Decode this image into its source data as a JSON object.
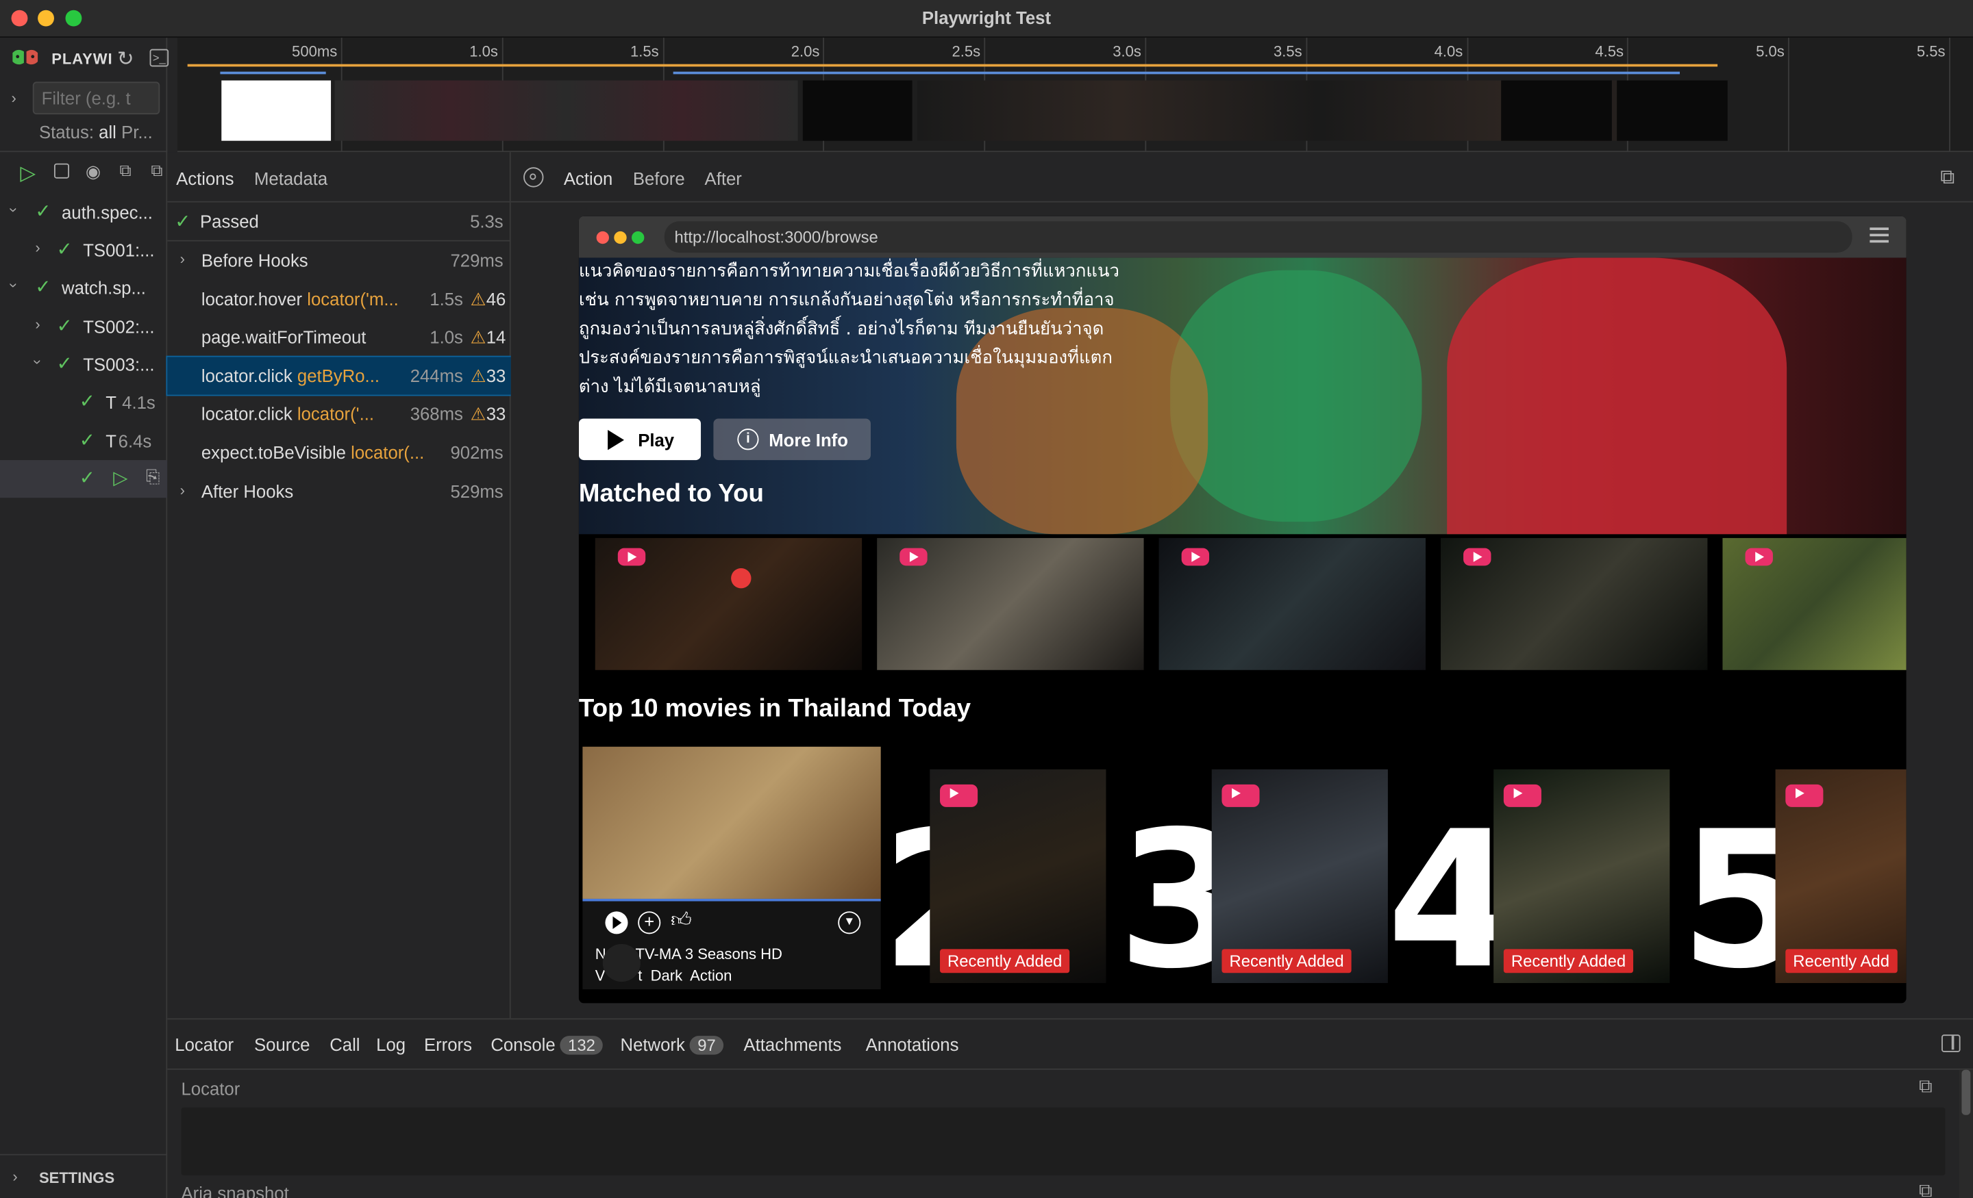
{
  "window": {
    "title": "Playwright Test"
  },
  "sidebar": {
    "app_name": "PLAYWI",
    "filter_placeholder": "Filter (e.g. t",
    "status_label": "Status:",
    "status_value": "all",
    "projects_label": "Pr...",
    "tree": [
      {
        "label": "auth.spec...",
        "indent": 0,
        "expanded": true
      },
      {
        "label": "TS001:...",
        "indent": 1,
        "expanded": false
      },
      {
        "label": "watch.sp...",
        "indent": 0,
        "expanded": true
      },
      {
        "label": "TS002:...",
        "indent": 1,
        "expanded": false
      },
      {
        "label": "TS003:...",
        "indent": 1,
        "expanded": true
      },
      {
        "label": "T",
        "time": "4.1s",
        "indent": 2
      },
      {
        "label": "T",
        "time": "6.4s",
        "indent": 2
      }
    ],
    "settings_label": "SETTINGS"
  },
  "timeline": {
    "ticks": [
      "500ms",
      "1.0s",
      "1.5s",
      "2.0s",
      "2.5s",
      "3.0s",
      "3.5s",
      "4.0s",
      "4.5s",
      "5.0s",
      "5.5s"
    ]
  },
  "actions_panel": {
    "tabs": [
      "Actions",
      "Metadata"
    ],
    "status": {
      "label": "Passed",
      "time": "5.3s"
    },
    "rows": [
      {
        "name": "Before Hooks",
        "locator": "",
        "time": "729ms",
        "warn": "",
        "expandable": true
      },
      {
        "name": "locator.hover",
        "locator": "locator('m...",
        "time": "1.5s",
        "warn": "46",
        "expandable": false
      },
      {
        "name": "page.waitForTimeout",
        "locator": "",
        "time": "1.0s",
        "warn": "14",
        "expandable": false
      },
      {
        "name": "locator.click",
        "locator": "getByRo...",
        "time": "244ms",
        "warn": "33",
        "expandable": false,
        "selected": true
      },
      {
        "name": "locator.click",
        "locator": "locator('...",
        "time": "368ms",
        "warn": "33",
        "expandable": false
      },
      {
        "name": "expect.toBeVisible",
        "locator": "locator(...",
        "time": "902ms",
        "warn": "",
        "expandable": false
      },
      {
        "name": "After Hooks",
        "locator": "",
        "time": "529ms",
        "warn": "",
        "expandable": true
      }
    ]
  },
  "snapshot": {
    "tabs": [
      "Action",
      "Before",
      "After"
    ],
    "url": "http://localhost:3000/browse",
    "hero_text": "แนวคิดของรายการคือการท้าทายความเชื่อเรื่องผีด้วยวิธีการที่แหวกแนว เช่น การพูดจาหยาบคาย การแกล้งกันอย่างสุดโต่ง หรือการกระทำที่อาจถูกมองว่าเป็นการลบหลู่สิ่งศักดิ์สิทธิ์ . อย่างไรก็ตาม ทีมงานยืนยันว่าจุดประสงค์ของรายการคือการพิสูจน์และนำเสนอความเชื่อในมุมมองที่แตกต่าง ไม่ได้มีเจตนาลบหลู่",
    "play_label": "Play",
    "more_info_label": "More Info",
    "matched_heading": "Matched to You",
    "top10_heading": "Top 10 movies in Thailand Today",
    "rank_numbers": [
      "2",
      "3",
      "4",
      "5"
    ],
    "recently_added_label": "Recently Added",
    "recently_added_cut": "Recently Add",
    "card_meta_1": "TV-MA",
    "card_meta_2": "3 Seasons",
    "card_meta_3": "HD",
    "card_genres": "t  Dark  Action",
    "card_prefix_1": "N",
    "card_prefix_2": "V"
  },
  "bottom_panel": {
    "tabs": [
      {
        "label": "Locator"
      },
      {
        "label": "Source"
      },
      {
        "label": "Call"
      },
      {
        "label": "Log"
      },
      {
        "label": "Errors"
      },
      {
        "label": "Console",
        "count": "132"
      },
      {
        "label": "Network",
        "count": "97"
      },
      {
        "label": "Attachments"
      },
      {
        "label": "Annotations"
      }
    ],
    "locator_heading": "Locator",
    "aria_heading": "Aria snapshot"
  }
}
